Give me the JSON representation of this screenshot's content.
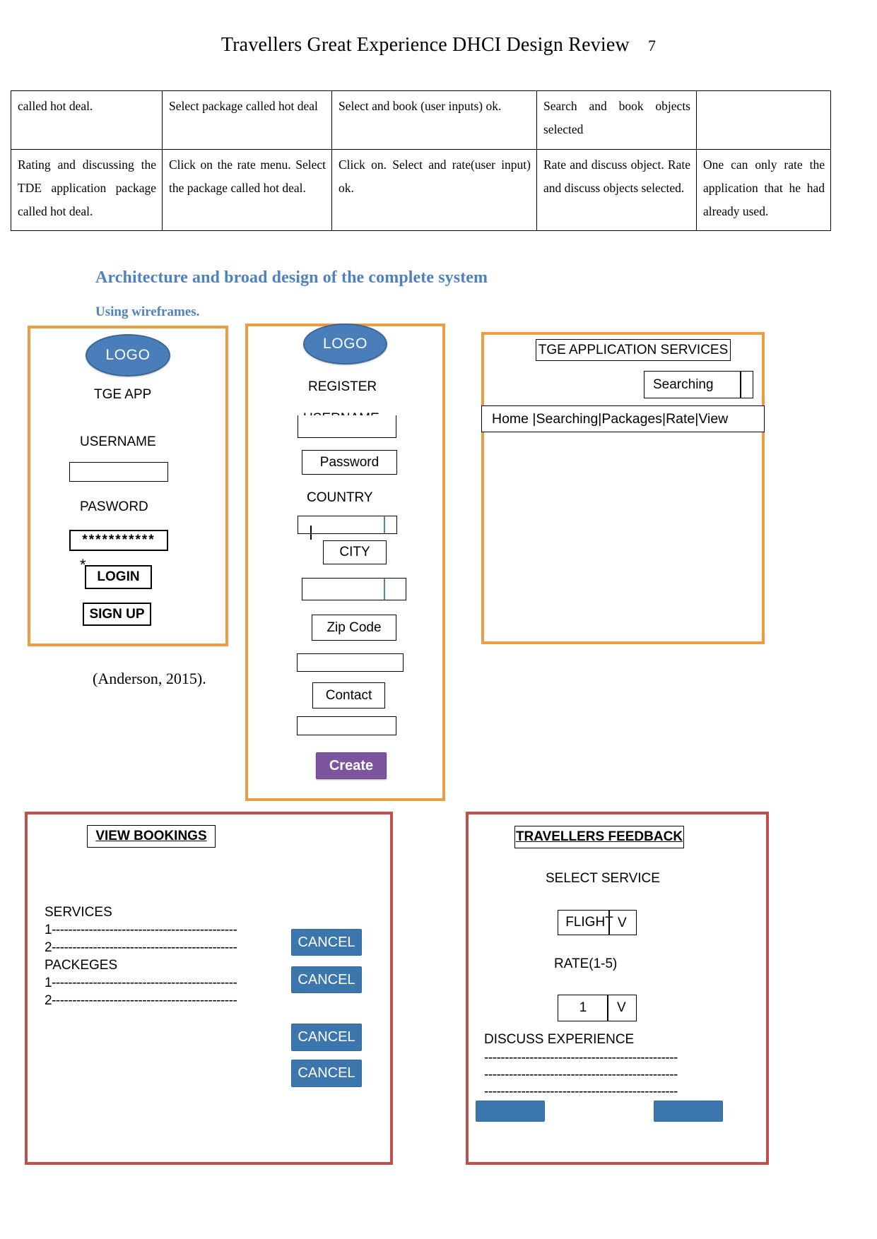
{
  "header": {
    "title": "Travellers Great Experience DHCI Design Review",
    "page_number": "7"
  },
  "table": {
    "rows": [
      {
        "c1": "called hot deal.",
        "c2": "Select package called hot deal",
        "c3": "Select and book (user inputs) ok.",
        "c4": "Search and book objects selected",
        "c5": ""
      },
      {
        "c1": "Rating and discussing the TDE application package called hot deal.",
        "c2": "Click on the rate menu. Select the package called hot deal.",
        "c3": "Click on. Select and rate(user input) ok.",
        "c4": "Rate and discuss object. Rate and discuss objects selected.",
        "c5": "One can only rate the application that he had already used."
      }
    ]
  },
  "headings": {
    "architecture": "Architecture and broad design of the complete system",
    "wireframes": "Using  wireframes."
  },
  "citation": "(Anderson, 2015).",
  "wireframe_login": {
    "logo": "LOGO",
    "app_title": "TGE APP",
    "username_label": "USERNAME",
    "username_value": "",
    "password_label": "PASWORD",
    "password_value": "***********",
    "asterisk": "*",
    "login_button": "LOGIN",
    "signup_button": "SIGN UP"
  },
  "wireframe_register": {
    "logo": "LOGO",
    "title": "REGISTER",
    "username_label": "USERNAME",
    "username_value": "",
    "password_field": "Password",
    "country_label": "COUNTRY",
    "country_value": "",
    "city_field": "CITY",
    "city_value": "",
    "zip_field": "Zip Code",
    "zip_value": "",
    "contact_field": "Contact",
    "contact_value": "",
    "create_button": "Create"
  },
  "wireframe_services": {
    "title": "TGE APPLICATION SERVICES",
    "search_box": "Searching",
    "nav_items": "Home |Searching|Packages|Rate|View"
  },
  "wireframe_bookings": {
    "title": "VIEW BOOKINGS",
    "services_label": "SERVICES",
    "services_items": [
      "1---------------------------------------------",
      "2---------------------------------------------"
    ],
    "packages_label": "PACKEGES",
    "packages_items": [
      "1---------------------------------------------",
      "2---------------------------------------------"
    ],
    "cancel_buttons": [
      "CANCEL",
      "CANCEL",
      "CANCEL",
      "CANCEL"
    ]
  },
  "wireframe_feedback": {
    "title": "TRAVELLERS FEEDBACK",
    "select_service_label": "SELECT  SERVICE",
    "service_value": "FLIGHT",
    "service_arrow": "V",
    "rate_label": "RATE(1-5)",
    "rate_value": "1",
    "rate_arrow": "V",
    "discuss_label": "DISCUSS EXPERIENCE",
    "discuss_lines": [
      "-----------------------------------------------",
      "-----------------------------------------------",
      "-----------------------------------------------"
    ]
  },
  "colors": {
    "heading_blue": "#4f81bd",
    "frame_orange": "#ed9c41",
    "frame_red": "#c0504d",
    "logo_blue": "#4a7ebb",
    "create_purple": "#7c559e",
    "cancel_blue": "#3b76ad"
  }
}
